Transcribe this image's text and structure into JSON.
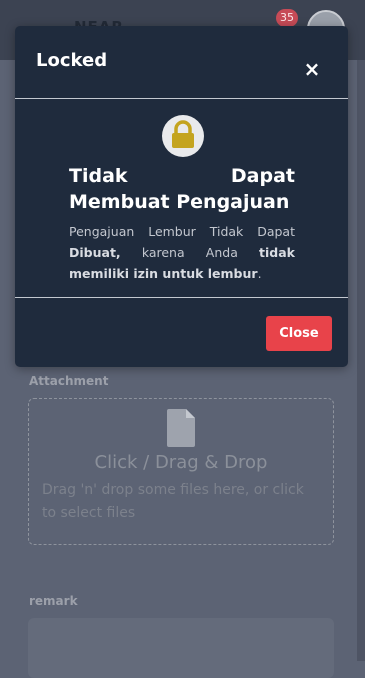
{
  "app": {
    "logo_text": "NEAR",
    "notification_count": "35"
  },
  "form": {
    "attachment_label": "Attachment",
    "dropzone_title": "Click / Drag & Drop",
    "dropzone_hint": "Drag 'n' drop some files here, or click to select files",
    "remark_label": "remark"
  },
  "modal": {
    "title": "Locked",
    "close_symbol": "×",
    "icon": "lock-icon",
    "heading": "Tidak Dapat Membuat Pengajuan",
    "message_parts": {
      "p1": "Pengajuan Lembur Tidak Dapat",
      "p2": "Dibuat,",
      "p3": " karena Anda ",
      "p4": "tidak memiliki izin untuk lembur",
      "p5": "."
    },
    "close_button": "Close"
  },
  "colors": {
    "modal_bg": "#1f2b3d",
    "close_button_bg": "#e8434a",
    "lock_gold": "#c4a41f",
    "badge": "#c74b57"
  }
}
